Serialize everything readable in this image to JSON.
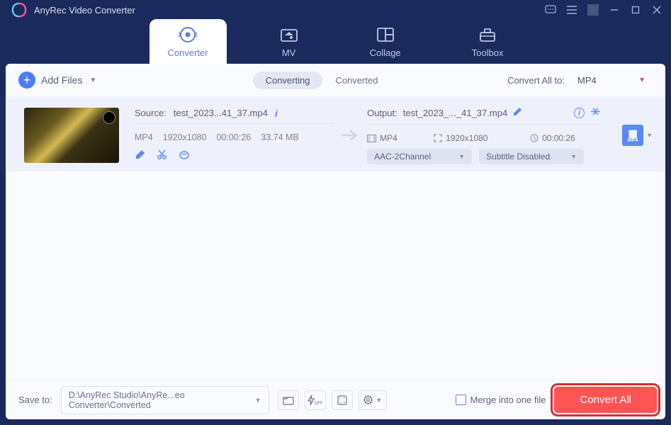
{
  "app": {
    "title": "AnyRec Video Converter"
  },
  "tabs": {
    "converter": "Converter",
    "mv": "MV",
    "collage": "Collage",
    "toolbox": "Toolbox"
  },
  "toolbar": {
    "add_files": "Add Files",
    "converting": "Converting",
    "converted": "Converted",
    "convert_all_to": "Convert All to:",
    "format": "MP4"
  },
  "file": {
    "source_label": "Source:",
    "source_name": "test_2023...41_37.mp4",
    "format": "MP4",
    "resolution": "1920x1080",
    "duration": "00:00:26",
    "size": "33.74 MB",
    "output_label": "Output:",
    "output_name": "test_2023_..._41_37.mp4",
    "out_format": "MP4",
    "out_resolution": "1920x1080",
    "out_duration": "00:00:26",
    "audio_select": "AAC-2Channel",
    "subtitle_select": "Subtitle Disabled",
    "format_badge": "MP4"
  },
  "footer": {
    "save_to": "Save to:",
    "path": "D:\\AnyRec Studio\\AnyRe...eo Converter\\Converted",
    "merge": "Merge into one file",
    "convert_all": "Convert All"
  }
}
